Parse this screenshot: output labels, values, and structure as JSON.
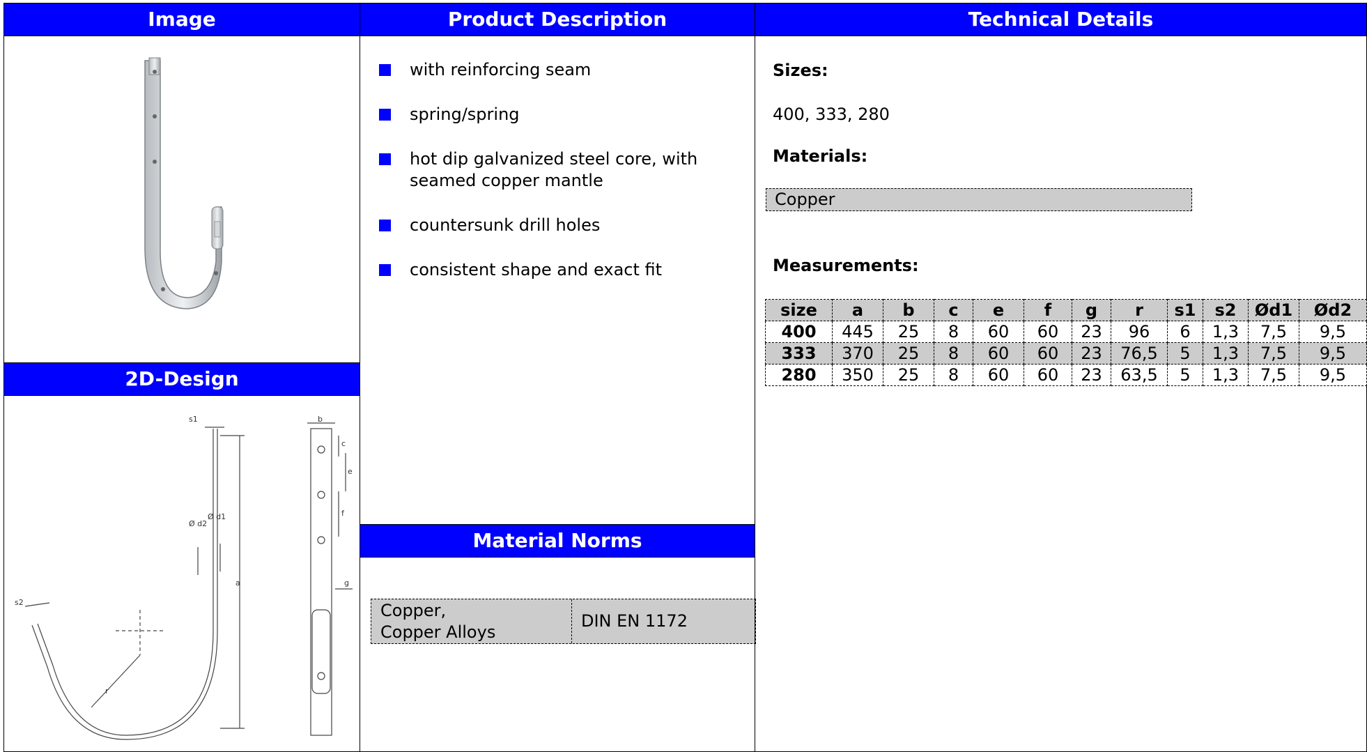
{
  "headers": {
    "image": "Image",
    "description": "Product Description",
    "technical": "Technical Details",
    "design": "2D-Design",
    "norms": "Material Norms"
  },
  "description_items": [
    "with reinforcing seam",
    "spring/spring",
    "hot dip galvanized steel core, with seamed copper mantle",
    "countersunk drill holes",
    "consistent shape and exact fit"
  ],
  "norms": {
    "material": "Copper,\nCopper Alloys",
    "standard": "DIN EN 1172"
  },
  "technical": {
    "sizes_label": "Sizes:",
    "sizes_value": "400, 333, 280",
    "materials_label": "Materials:",
    "material_value": "Copper",
    "measurements_label": "Measurements:"
  },
  "measurements": {
    "columns": [
      "size",
      "a",
      "b",
      "c",
      "e",
      "f",
      "g",
      "r",
      "s1",
      "s2",
      "Ød1",
      "Ød2"
    ],
    "rows": [
      [
        "400",
        "445",
        "25",
        "8",
        "60",
        "60",
        "23",
        "96",
        "6",
        "1,3",
        "7,5",
        "9,5"
      ],
      [
        "333",
        "370",
        "25",
        "8",
        "60",
        "60",
        "23",
        "76,5",
        "5",
        "1,3",
        "7,5",
        "9,5"
      ],
      [
        "280",
        "350",
        "25",
        "8",
        "60",
        "60",
        "23",
        "63,5",
        "5",
        "1,3",
        "7,5",
        "9,5"
      ]
    ]
  },
  "drawing_labels": {
    "s1": "s1",
    "s2": "s2",
    "d2": "Ø d2",
    "d1": "Ø d1",
    "a": "a",
    "r": "r",
    "b": "b",
    "c": "c",
    "e": "e",
    "f": "f",
    "g": "g"
  },
  "colors": {
    "header_bg": "#0000ff",
    "cell_gray": "#cccccc"
  }
}
